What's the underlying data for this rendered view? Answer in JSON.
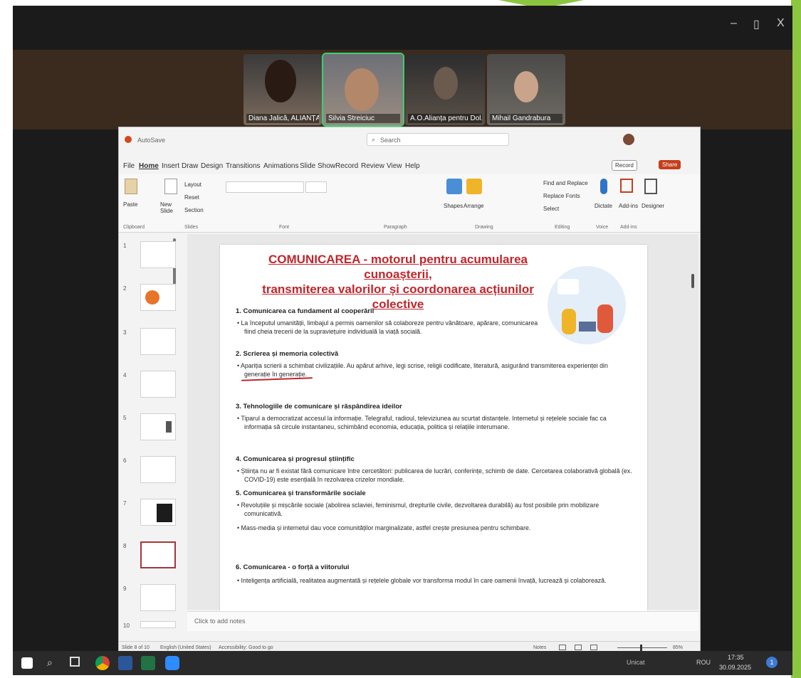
{
  "colors": {
    "accent_red": "#c0262c",
    "meeting_bg": "#1b1b1b",
    "green": "#8cc63f",
    "highlight": "#3cd070"
  },
  "participants": [
    {
      "name": "Diana Jalică, ALIANȚA ..."
    },
    {
      "name": "Silvia Streiciuc"
    },
    {
      "name": "A.O.Alianța pentru Dol..."
    },
    {
      "name": "Mihail Gandrabura"
    }
  ],
  "window_controls": {
    "minimize": "–",
    "restore": "▯",
    "close": "X"
  },
  "ppt": {
    "title_items": {
      "autosave": "AutoSave",
      "search": "Search"
    },
    "menu": [
      "File",
      "Home",
      "Insert",
      "Draw",
      "Design",
      "Transitions",
      "Animations",
      "Slide Show",
      "Record",
      "Review",
      "View",
      "Help"
    ],
    "record_label": "Record",
    "share_label": "Share",
    "ribbon": {
      "paste": "Paste",
      "new_slide": "New Slide",
      "layout": "Layout",
      "reset": "Reset",
      "section": "Section",
      "shapes": "Shapes",
      "arrange": "Arrange",
      "find_replace": "Find and Replace",
      "replace_fonts": "Replace Fonts",
      "select": "Select",
      "dictate": "Dictate",
      "addins": "Add-ins",
      "designer": "Designer",
      "groups": [
        "Clipboard",
        "Slides",
        "Font",
        "Paragraph",
        "Drawing",
        "Editing",
        "Voice",
        "Add-ins"
      ]
    },
    "slide_numbers": [
      "1",
      "2",
      "3",
      "4",
      "5",
      "6",
      "7",
      "8",
      "9",
      "10"
    ],
    "notes_placeholder": "Click to add notes",
    "status": {
      "slide_of": "Slide 8 of 10",
      "language": "English (United States)",
      "accessibility": "Accessibility: Good to go",
      "notes": "Notes",
      "zoom": "85%"
    }
  },
  "slide": {
    "title_line1": "COMUNICAREA - motorul pentru acumularea cunoașterii,",
    "title_line2": "transmiterea valorilor și coordonarea acțiunilor colective",
    "sections": [
      {
        "heading": "1. Comunicarea ca fundament al cooperării",
        "bullets": [
          "La începutul umanității, limbajul a permis oamenilor să colaboreze pentru vânătoare, apărare, comunicarea fiind cheia trecerii de la supraviețuire individuală la viață socială."
        ]
      },
      {
        "heading": "2. Scrierea și memoria colectivă",
        "bullets": [
          "Apariția scrierii a schimbat civilizațiile. Au apărut arhive, legi scrise, religii codificate, literatură, asigurând transmiterea experienței din generație în generație."
        ]
      },
      {
        "heading": "3. Tehnologiile de comunicare și răspândirea ideilor",
        "bullets": [
          "Tiparul a democratizat accesul la informație. Telegraful, radioul, televiziunea au scurtat distanțele. Internetul și rețelele sociale fac ca informația să circule instantaneu, schimbând economia, educația, politica și relațiile interumane."
        ]
      },
      {
        "heading": "4. Comunicarea și progresul științific",
        "bullets": [
          "Știința nu ar fi existat fără comunicare între cercetători: publicarea de lucrări, conferințe, schimb de date. Cercetarea colaborativă globală (ex. COVID-19) este esențială în rezolvarea crizelor mondiale."
        ]
      },
      {
        "heading": "5. Comunicarea și transformările sociale",
        "bullets": [
          "Revoluțiile și mișcările sociale (abolirea sclaviei, feminismul, drepturile civile, dezvoltarea durabilă) au fost posibile prin mobilizare comunicativă.",
          "Mass-media și internetul dau voce comunităților marginalizate, astfel crește presiunea pentru schimbare."
        ]
      },
      {
        "heading": "6. Comunicarea - o forță a viitorului",
        "bullets": [
          "Inteligența artificială, realitatea augmentată și rețelele globale vor transforma modul în care oamenii învață, lucrează și colaborează."
        ]
      }
    ]
  },
  "taskbar": {
    "weather": "Unicat",
    "lang": "ROU",
    "time": "17:35",
    "date": "30.09.2025",
    "notification_count": "1"
  }
}
